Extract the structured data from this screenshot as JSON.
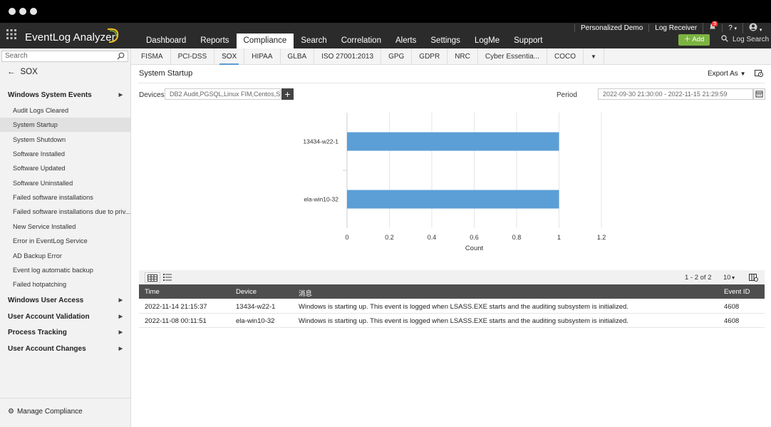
{
  "app": {
    "name": "EventLog Analyzer",
    "top_links": [
      "Personalized Demo",
      "Log Receiver",
      "?"
    ],
    "notification_count": "5",
    "add_label": "Add",
    "log_search_label": "Log Search"
  },
  "nav": {
    "tabs": [
      "Dashboard",
      "Reports",
      "Compliance",
      "Search",
      "Correlation",
      "Alerts",
      "Settings",
      "LogMe",
      "Support"
    ],
    "active": "Compliance"
  },
  "subnav": {
    "tabs": [
      "FISMA",
      "PCI-DSS",
      "SOX",
      "HIPAA",
      "GLBA",
      "ISO 27001:2013",
      "GPG",
      "GDPR",
      "NRC",
      "Cyber Essentia...",
      "COCO"
    ],
    "active": "SOX"
  },
  "sidebar": {
    "search_placeholder": "Search",
    "back_label": "SOX",
    "section1": "Windows System Events",
    "items": [
      "Audit Logs Cleared",
      "System Startup",
      "System Shutdown",
      "Software Installed",
      "Software Updated",
      "Software Uninstalled",
      "Failed software installations",
      "Failed software installations due to priv...",
      "New Service Installed",
      "Error in EventLog Service",
      "AD Backup Error",
      "Event log automatic backup",
      "Failed hotpatching"
    ],
    "active_item": "System Startup",
    "sections": [
      "Windows User Access",
      "User Account Validation",
      "Process Tracking",
      "User Account Changes"
    ],
    "footer": "Manage Compliance"
  },
  "report": {
    "title": "System Startup",
    "export_label": "Export As",
    "devices_label": "Devices",
    "devices_value": "DB2 Audit,PGSQL,Linux FIM,Centos,S...",
    "period_label": "Period",
    "period_value": "2022-09-30 21:30:00 - 2022-11-15 21:29:59"
  },
  "chart_data": {
    "type": "bar",
    "orientation": "horizontal",
    "categories": [
      "13434-w22-1",
      "ela-win10-32"
    ],
    "values": [
      1,
      1
    ],
    "xlabel": "Count",
    "ylabel": "",
    "xlim": [
      0,
      1.2
    ],
    "xticks": [
      "0",
      "0.2",
      "0.4",
      "0.6",
      "0.8",
      "1",
      "1.2"
    ],
    "grid": true,
    "color": "#5b9fd6"
  },
  "table": {
    "pagination": "1 - 2 of 2",
    "page_size": "10",
    "headers": [
      "Time",
      "Device",
      "消息",
      "Event ID"
    ],
    "rows": [
      [
        "2022-11-14 21:15:37",
        "13434-w22-1",
        "Windows is starting up. This event is logged when LSASS.EXE starts and the auditing subsystem is initialized.",
        "4608"
      ],
      [
        "2022-11-08 00:11:51",
        "ela-win10-32",
        "Windows is starting up. This event is logged when LSASS.EXE starts and the auditing subsystem is initialized.",
        "4608"
      ]
    ]
  }
}
